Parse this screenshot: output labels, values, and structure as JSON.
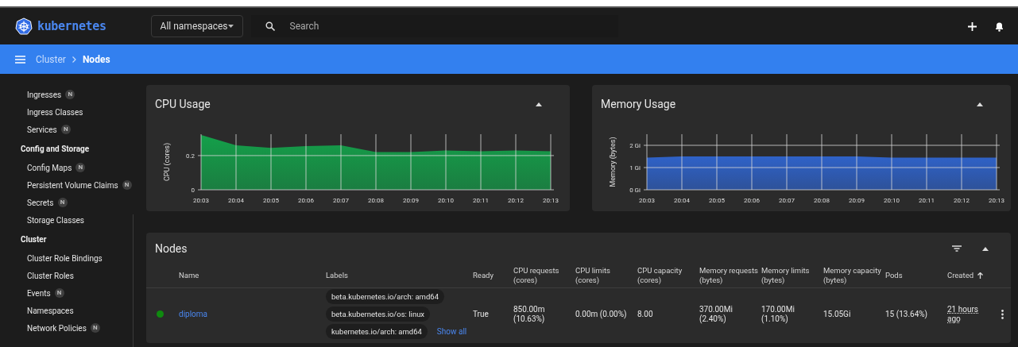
{
  "header": {
    "brand": "kubernetes",
    "namespace_select": "All namespaces",
    "search": {
      "placeholder": "Search"
    }
  },
  "breadcrumb": [
    "Cluster",
    "Nodes"
  ],
  "sidebar": {
    "sections": [
      {
        "items": [
          {
            "label": "Ingresses",
            "badge": "N"
          },
          {
            "label": "Ingress Classes"
          },
          {
            "label": "Services",
            "badge": "N"
          }
        ]
      },
      {
        "title": "Config and Storage",
        "items": [
          {
            "label": "Config Maps",
            "badge": "N"
          },
          {
            "label": "Persistent Volume Claims",
            "badge": "N"
          },
          {
            "label": "Secrets",
            "badge": "N"
          },
          {
            "label": "Storage Classes"
          }
        ]
      },
      {
        "title": "Cluster",
        "items": [
          {
            "label": "Cluster Role Bindings"
          },
          {
            "label": "Cluster Roles"
          },
          {
            "label": "Events",
            "badge": "N"
          },
          {
            "label": "Namespaces"
          },
          {
            "label": "Network Policies",
            "badge": "N"
          }
        ]
      }
    ]
  },
  "charts": [
    {
      "title": "CPU Usage",
      "chart_data": {
        "type": "area",
        "ylabel": "CPU (cores)",
        "categories": [
          "20:03",
          "20:04",
          "20:05",
          "20:06",
          "20:07",
          "20:08",
          "20:09",
          "20:10",
          "20:11",
          "20:12",
          "20:13"
        ],
        "grid": true,
        "series": [
          {
            "color": "#14a04a",
            "values": [
              0.32,
              0.26,
              0.245,
              0.255,
              0.26,
              0.22,
              0.22,
              0.23,
              0.225,
              0.23,
              0.225
            ]
          }
        ],
        "ylim": [
          0,
          0.325
        ],
        "yticks": [
          0,
          0.2
        ]
      }
    },
    {
      "title": "Memory Usage",
      "chart_data": {
        "type": "area",
        "ylabel": "Memory (bytes)",
        "categories": [
          "20:03",
          "20:04",
          "20:05",
          "20:06",
          "20:07",
          "20:08",
          "20:09",
          "20:10",
          "20:11",
          "20:12",
          "20:13"
        ],
        "grid": true,
        "series": [
          {
            "color": "#2f62c8",
            "values": [
              1.45,
              1.5,
              1.5,
              1.5,
              1.5,
              1.5,
              1.5,
              1.45,
              1.45,
              1.45,
              1.45
            ]
          }
        ],
        "ylim": [
          0,
          2.5
        ],
        "yticks": [
          {
            "value": 0,
            "label": "0 Gi"
          },
          {
            "value": 1,
            "label": "1 Gi"
          },
          {
            "value": 2,
            "label": "2 Gi"
          }
        ]
      }
    }
  ],
  "nodes": {
    "title": "Nodes",
    "columns": [
      {
        "label": "Name",
        "sorted": false
      },
      {
        "label": "Labels",
        "sorted": false
      },
      {
        "label": "Ready",
        "sorted": false
      },
      {
        "label": "CPU requests (cores)",
        "sorted": false
      },
      {
        "label": "CPU limits (cores)",
        "sorted": false
      },
      {
        "label": "CPU capacity (cores)",
        "sorted": false
      },
      {
        "label": "Memory requests (bytes)",
        "sorted": false
      },
      {
        "label": "Memory limits (bytes)",
        "sorted": false
      },
      {
        "label": "Memory capacity (bytes)",
        "sorted": false
      },
      {
        "label": "Pods",
        "sorted": false
      },
      {
        "label": "Created",
        "sorted": true
      }
    ],
    "rows": [
      {
        "color": "#0f8a0f",
        "name": "diploma",
        "labels": [
          "beta.kubernetes.io/arch: amd64",
          "beta.kubernetes.io/os: linux",
          "kubernetes.io/arch: amd64"
        ],
        "show_all": "Show all",
        "ready": "True",
        "cpu_requests": "850.00m (10.63%)",
        "cpu_limits": "0.00m (0.00%)",
        "cpu_capacity": "8.00",
        "memory_requests": "370.00Mi (2.40%)",
        "memory_limits": "170.00Mi (1.10%)",
        "memory_capacity": "15.05Gi",
        "pods": "15 (13.64%)",
        "created": "21 hours ago"
      }
    ]
  }
}
